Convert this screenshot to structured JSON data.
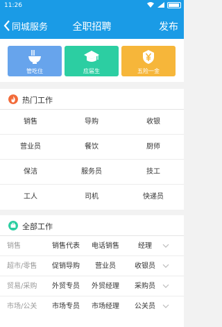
{
  "status_bar": {
    "time": "11:26"
  },
  "nav": {
    "back_label": "同城服务",
    "title": "全职招聘",
    "publish_label": "发布"
  },
  "quick_tiles": [
    {
      "label": "管吃住",
      "icon": "noodle-bowl-icon",
      "color": "#67a4ec"
    },
    {
      "label": "应届生",
      "icon": "graduation-cap-icon",
      "color": "#2ccea2"
    },
    {
      "label": "五险一金",
      "icon": "yuan-coin-icon",
      "color": "#f6b63a"
    }
  ],
  "hot_jobs": {
    "title": "热门工作",
    "icon": "flame-icon",
    "icon_color": "#f26b3a",
    "rows": [
      [
        "销售",
        "导购",
        "收银"
      ],
      [
        "营业员",
        "餐饮",
        "厨师"
      ],
      [
        "保洁",
        "服务员",
        "技工"
      ],
      [
        "工人",
        "司机",
        "快递员"
      ]
    ]
  },
  "all_jobs": {
    "title": "全部工作",
    "icon": "briefcase-icon",
    "icon_color": "#2ccea2",
    "categories": [
      {
        "category": "销售",
        "jobs": [
          "销售代表",
          "电话销售",
          "经理"
        ]
      },
      {
        "category": "超市/零售",
        "jobs": [
          "促销导购",
          "营业员",
          "收银员"
        ]
      },
      {
        "category": "贸易/采购",
        "jobs": [
          "外贸专员",
          "外贸经理",
          "采购员"
        ]
      },
      {
        "category": "市场/公关",
        "jobs": [
          "市场专员",
          "市场经理",
          "公关员"
        ]
      }
    ]
  }
}
